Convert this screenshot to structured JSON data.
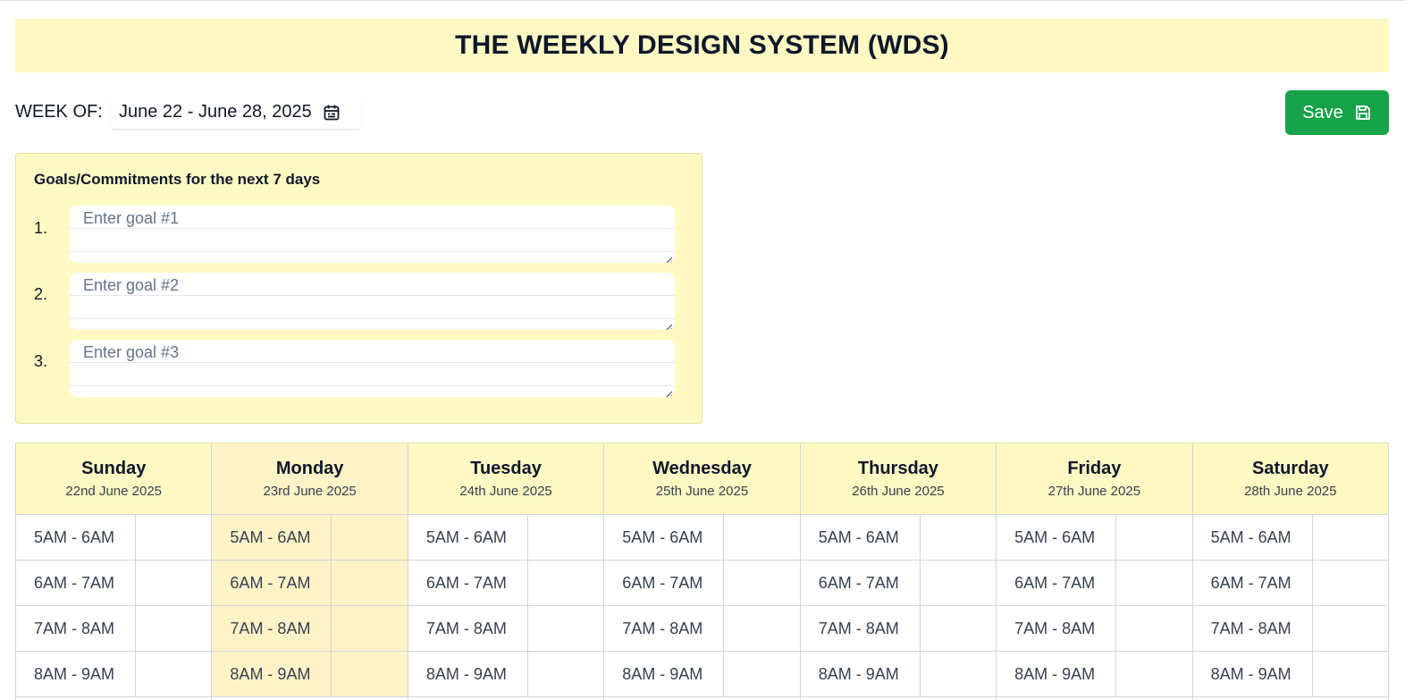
{
  "header": {
    "title": "THE WEEKLY DESIGN SYSTEM (WDS)"
  },
  "week": {
    "label": "WEEK OF:",
    "range": "June 22 - June 28, 2025",
    "icon": "calendar-icon"
  },
  "toolbar": {
    "save_label": "Save",
    "save_icon": "floppy-disk-icon",
    "save_color": "#16a34a"
  },
  "goals": {
    "title": "Goals/Commitments for the next 7 days",
    "items": [
      {
        "number": "1.",
        "placeholder": "Enter goal #1"
      },
      {
        "number": "2.",
        "placeholder": "Enter goal #2"
      },
      {
        "number": "3.",
        "placeholder": "Enter goal #3"
      }
    ]
  },
  "days": [
    {
      "name": "Sunday",
      "date": "22nd June 2025"
    },
    {
      "name": "Monday",
      "date": "23rd June 2025",
      "highlighted": true
    },
    {
      "name": "Tuesday",
      "date": "24th June 2025"
    },
    {
      "name": "Wednesday",
      "date": "25th June 2025"
    },
    {
      "name": "Thursday",
      "date": "26th June 2025"
    },
    {
      "name": "Friday",
      "date": "27th June 2025"
    },
    {
      "name": "Saturday",
      "date": "28th June 2025"
    }
  ],
  "slots": [
    "5AM - 6AM",
    "6AM - 7AM",
    "7AM - 8AM",
    "8AM - 9AM"
  ],
  "colors": {
    "accent_yellow": "#fef9c3",
    "today_highlight": "#fef3c7",
    "save_green": "#16a34a"
  }
}
